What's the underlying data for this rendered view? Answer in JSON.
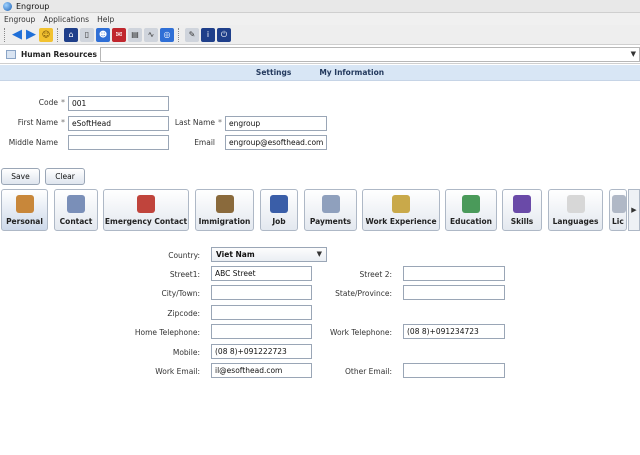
{
  "window": {
    "title": "Engroup"
  },
  "menu": [
    "Engroup",
    "Applications",
    "Help"
  ],
  "breadcrumb": {
    "module": "Human Resources"
  },
  "subnav": {
    "settings": "Settings",
    "my_information": "My Information"
  },
  "form": {
    "code_label": "Code",
    "code_value": "001",
    "first_name_label": "First Name",
    "first_name_value": "eSoftHead",
    "last_name_label": "Last Name",
    "last_name_value": "engroup",
    "middle_name_label": "Middle Name",
    "middle_name_value": "",
    "email_label": "Email",
    "email_value": "engroup@esofthead.com",
    "required_marker": "*"
  },
  "actions": {
    "save": "Save",
    "clear": "Clear"
  },
  "tabs": [
    {
      "label": "Personal"
    },
    {
      "label": "Contact"
    },
    {
      "label": "Emergency Contact"
    },
    {
      "label": "Immigration"
    },
    {
      "label": "Job"
    },
    {
      "label": "Payments"
    },
    {
      "label": "Work Experience"
    },
    {
      "label": "Education"
    },
    {
      "label": "Skills"
    },
    {
      "label": "Languages"
    },
    {
      "label": "Lic"
    }
  ],
  "contact": {
    "country_label": "Country:",
    "country_value": "Viet Nam",
    "street1_label": "Street1:",
    "street1_value": "ABC Street",
    "street2_label": "Street 2:",
    "street2_value": "",
    "city_label": "City/Town:",
    "city_value": "",
    "state_label": "State/Province:",
    "state_value": "",
    "zip_label": "Zipcode:",
    "zip_value": "",
    "home_phone_label": "Home Telephone:",
    "home_phone_value": "",
    "work_phone_label": "Work Telephone:",
    "work_phone_value": "(08 8)+091234723",
    "mobile_label": "Mobile:",
    "mobile_value": "(08 8)+091222723",
    "work_email_label": "Work Email:",
    "work_email_value": "il@esofthead.com",
    "other_email_label": "Other Email:",
    "other_email_value": ""
  },
  "colors": {
    "subnav_bg": "#d8e6f5",
    "accent": "#2f6fd6"
  }
}
